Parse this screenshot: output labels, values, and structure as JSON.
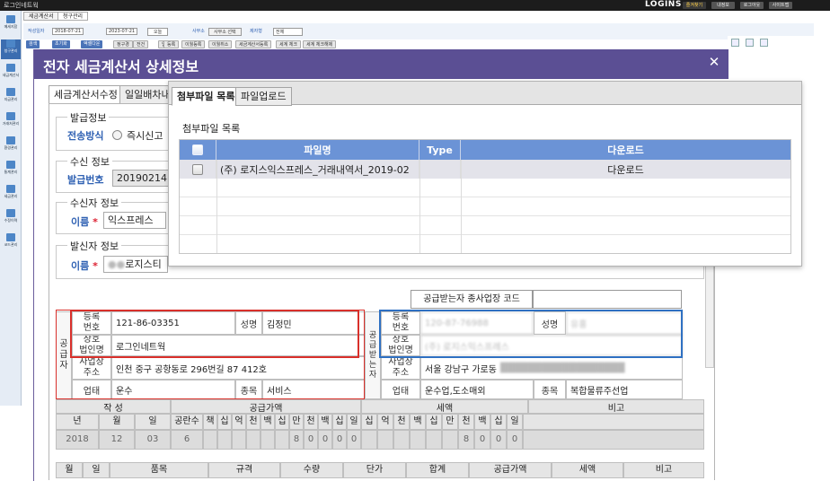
{
  "app": {
    "window_title": "로그인네트웍",
    "brand": "LOGINS",
    "top_buttons": [
      "즐겨찾기",
      "내정보",
      "로그아웃",
      "사이트맵"
    ],
    "sidebar": [
      "메세지함",
      "청구관리",
      "세금계산서",
      "지급관리",
      "거래처관리",
      "환경관리",
      "통계관리",
      "세금관리",
      "수정이력",
      "코드관리"
    ],
    "tabs": [
      "세금계산서",
      "청구관리"
    ],
    "filter": {
      "date_label": "작성일자",
      "date_from": "2018-07-21",
      "date_to": "2023-07-21",
      "period": "오늘",
      "office_label": "사무소",
      "office_button": "사무소 선택",
      "type_label": "제자형",
      "type_value": "전체"
    },
    "toolbar": [
      "검색",
      "초기화",
      "엑셀다운",
      "정구경",
      "전건",
      "업로드",
      "등록",
      "이월등록",
      "이월취소",
      "세금계산서등록",
      "세계 체크",
      "세계 체크해제"
    ]
  },
  "modal": {
    "title": "전자 세금계산서 상세정보",
    "close_label": "✕",
    "tabs": [
      "세금계산서수정",
      "일일배차내역"
    ],
    "issue": {
      "legend": "발급정보",
      "method_label": "전송방식",
      "method_option": "즉시신고"
    },
    "receipt": {
      "legend": "수신 정보",
      "number_label": "발급번호",
      "number_value": "2019021412"
    },
    "receiver": {
      "legend": "수신자 정보",
      "name_label": "이름",
      "name_value": "익스프레스"
    },
    "sender": {
      "legend": "발신자 정보",
      "name_label": "이름",
      "name_value": "로지스티"
    },
    "invoice": {
      "buyer_code_label": "공급받는자 종사업장 코드",
      "supplier_side_label": [
        "공",
        "급",
        "자"
      ],
      "buyer_side_label": [
        "공",
        "급",
        "받",
        "는",
        "자"
      ],
      "supplier": {
        "reg_label": [
          "등록",
          "번호"
        ],
        "reg_value": "121-86-03351",
        "rep_label": "성명",
        "rep_value": "김정민",
        "company_label": [
          "상호",
          "법인명"
        ],
        "company_value": "로그인네트웍",
        "address_label": [
          "사업장",
          "주소"
        ],
        "address_value": "인천 중구 공항동로 296번길 87 412호",
        "business_label": "업태",
        "business_value": "운수",
        "item_label": "종목",
        "item_value": "서비스"
      },
      "buyer": {
        "reg_label": [
          "등록",
          "번호"
        ],
        "reg_value": "120-87-76988",
        "rep_label": "성명",
        "rep_value": "유홍",
        "company_label": [
          "상호",
          "법인명"
        ],
        "company_value": "(주) 로지스익스프레스",
        "address_label": [
          "사업장",
          "주소"
        ],
        "address_value": "서울 강남구 가로동",
        "business_label": "업태",
        "business_value": "운수업,도소매외",
        "item_label": "종목",
        "item_value": "복합물류주선업"
      },
      "table": {
        "group_headers": [
          "작 성",
          "공급가액",
          "세액",
          "비고"
        ],
        "date_headers": [
          "년",
          "월",
          "일"
        ],
        "blank_count_label": "공란수",
        "digit_headers": [
          "책",
          "십",
          "억",
          "천",
          "백",
          "십",
          "만",
          "천",
          "백",
          "십",
          "일"
        ],
        "tax_digit_headers": [
          "십",
          "억",
          "천",
          "백",
          "십",
          "만",
          "천",
          "백",
          "십",
          "일"
        ],
        "date_values": [
          "2018",
          "12",
          "03"
        ],
        "blank_count_value": "6",
        "supply_digits": [
          "8",
          "0",
          "0",
          "0",
          "0"
        ],
        "tax_digits": [
          "8",
          "0",
          "0",
          "0"
        ],
        "item_headers": [
          "월",
          "일",
          "품목",
          "규격",
          "수량",
          "단가",
          "합계",
          "공급가액",
          "세액",
          "비고"
        ]
      }
    }
  },
  "popup": {
    "tabs": [
      "첨부파일 목록",
      "파일업로드"
    ],
    "group_title": "첨부파일 목록",
    "columns": [
      "",
      "파일명",
      "Type",
      "다운로드"
    ],
    "rows": [
      {
        "file_name": "(주) 로지스익스프레스_거래내역서_2019-02",
        "type": "",
        "download": "다운로드"
      }
    ]
  }
}
